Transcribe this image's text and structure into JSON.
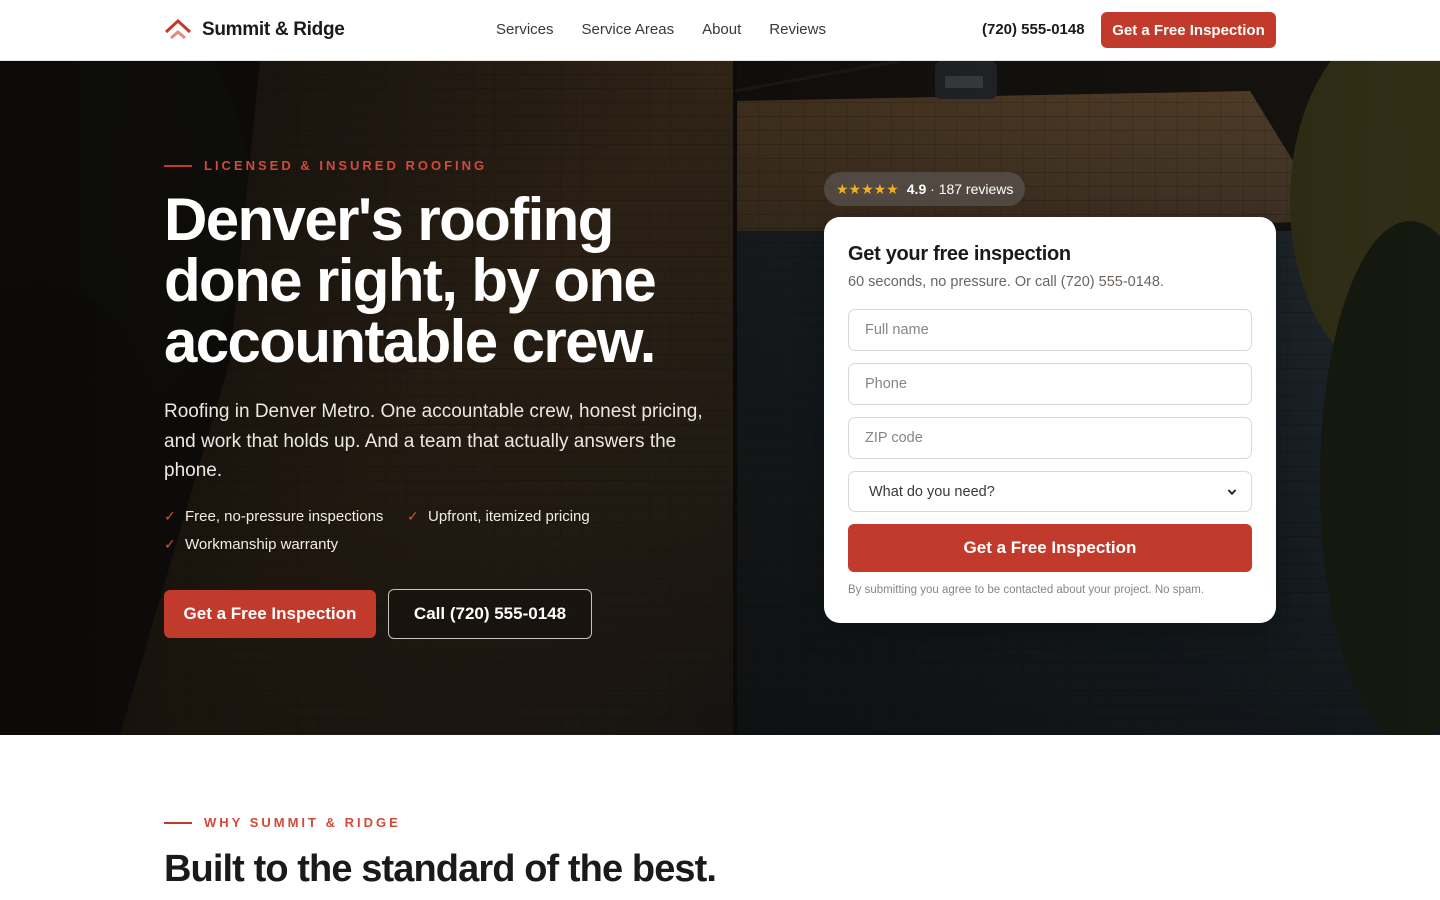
{
  "header": {
    "brand_name": "Summit & Ridge",
    "nav": [
      "Services",
      "Service Areas",
      "About",
      "Reviews"
    ],
    "phone": "(720) 555-0148",
    "cta_label": "Get a Free Inspection"
  },
  "hero": {
    "eyebrow": "Licensed & Insured Roofing",
    "title": "Denver's roofing done right, by one accountable crew.",
    "subtitle": "Roofing in Denver Metro. One accountable crew, honest pricing, and work that holds up. And a team that actually answers the phone.",
    "features": [
      "Free, no-pressure inspections",
      "Upfront, itemized pricing",
      "Workmanship warranty"
    ],
    "primary_cta": "Get a Free Inspection",
    "secondary_cta": "Call (720) 555-0148"
  },
  "rating": {
    "stars": "★★★★★",
    "score": "4.9",
    "separator": " · ",
    "reviews": "187 reviews"
  },
  "form": {
    "title": "Get your free inspection",
    "subtitle": "60 seconds, no pressure. Or call (720) 555-0148.",
    "name_placeholder": "Full name",
    "phone_placeholder": "Phone",
    "zip_placeholder": "ZIP code",
    "select_value": "What do you need?",
    "submit_label": "Get a Free Inspection",
    "legal": "By submitting you agree to be contacted about your project. No spam."
  },
  "why": {
    "eyebrow": "Why Summit & Ridge",
    "title": "Built to the standard of the best."
  },
  "colors": {
    "accent": "#c23a2b",
    "star": "#f2b01e",
    "text_dark": "#1c1a19"
  },
  "icons": {
    "logo": "roof-chevron-icon",
    "check": "checkmark-icon",
    "select": "chevron-down-icon"
  }
}
